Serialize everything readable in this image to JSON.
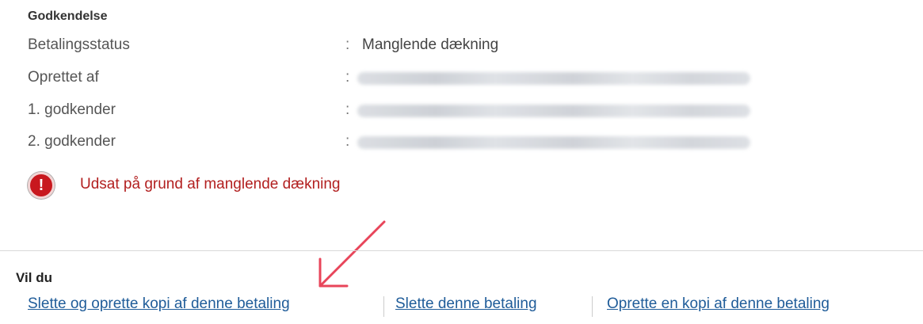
{
  "section": {
    "title": "Godkendelse",
    "rows": [
      {
        "label": "Betalingsstatus",
        "separator": ":",
        "value": "Manglende dækning"
      },
      {
        "label": "Oprettet af",
        "separator": ":",
        "value": ""
      },
      {
        "label": "1. godkender",
        "separator": ":",
        "value": ""
      },
      {
        "label": "2. godkender",
        "separator": ":",
        "value": ""
      }
    ]
  },
  "alert": {
    "icon": "exclamation-icon",
    "icon_glyph": "!",
    "message": "Udsat på grund af manglende dækning",
    "color": "#b21f1f"
  },
  "actions": {
    "heading": "Vil du",
    "links": [
      "Slette og oprette kopi af denne betaling",
      "Slette denne betaling",
      "Oprette en kopi af denne betaling"
    ]
  },
  "annotation": {
    "icon": "arrow-icon",
    "color": "#e8455a"
  }
}
